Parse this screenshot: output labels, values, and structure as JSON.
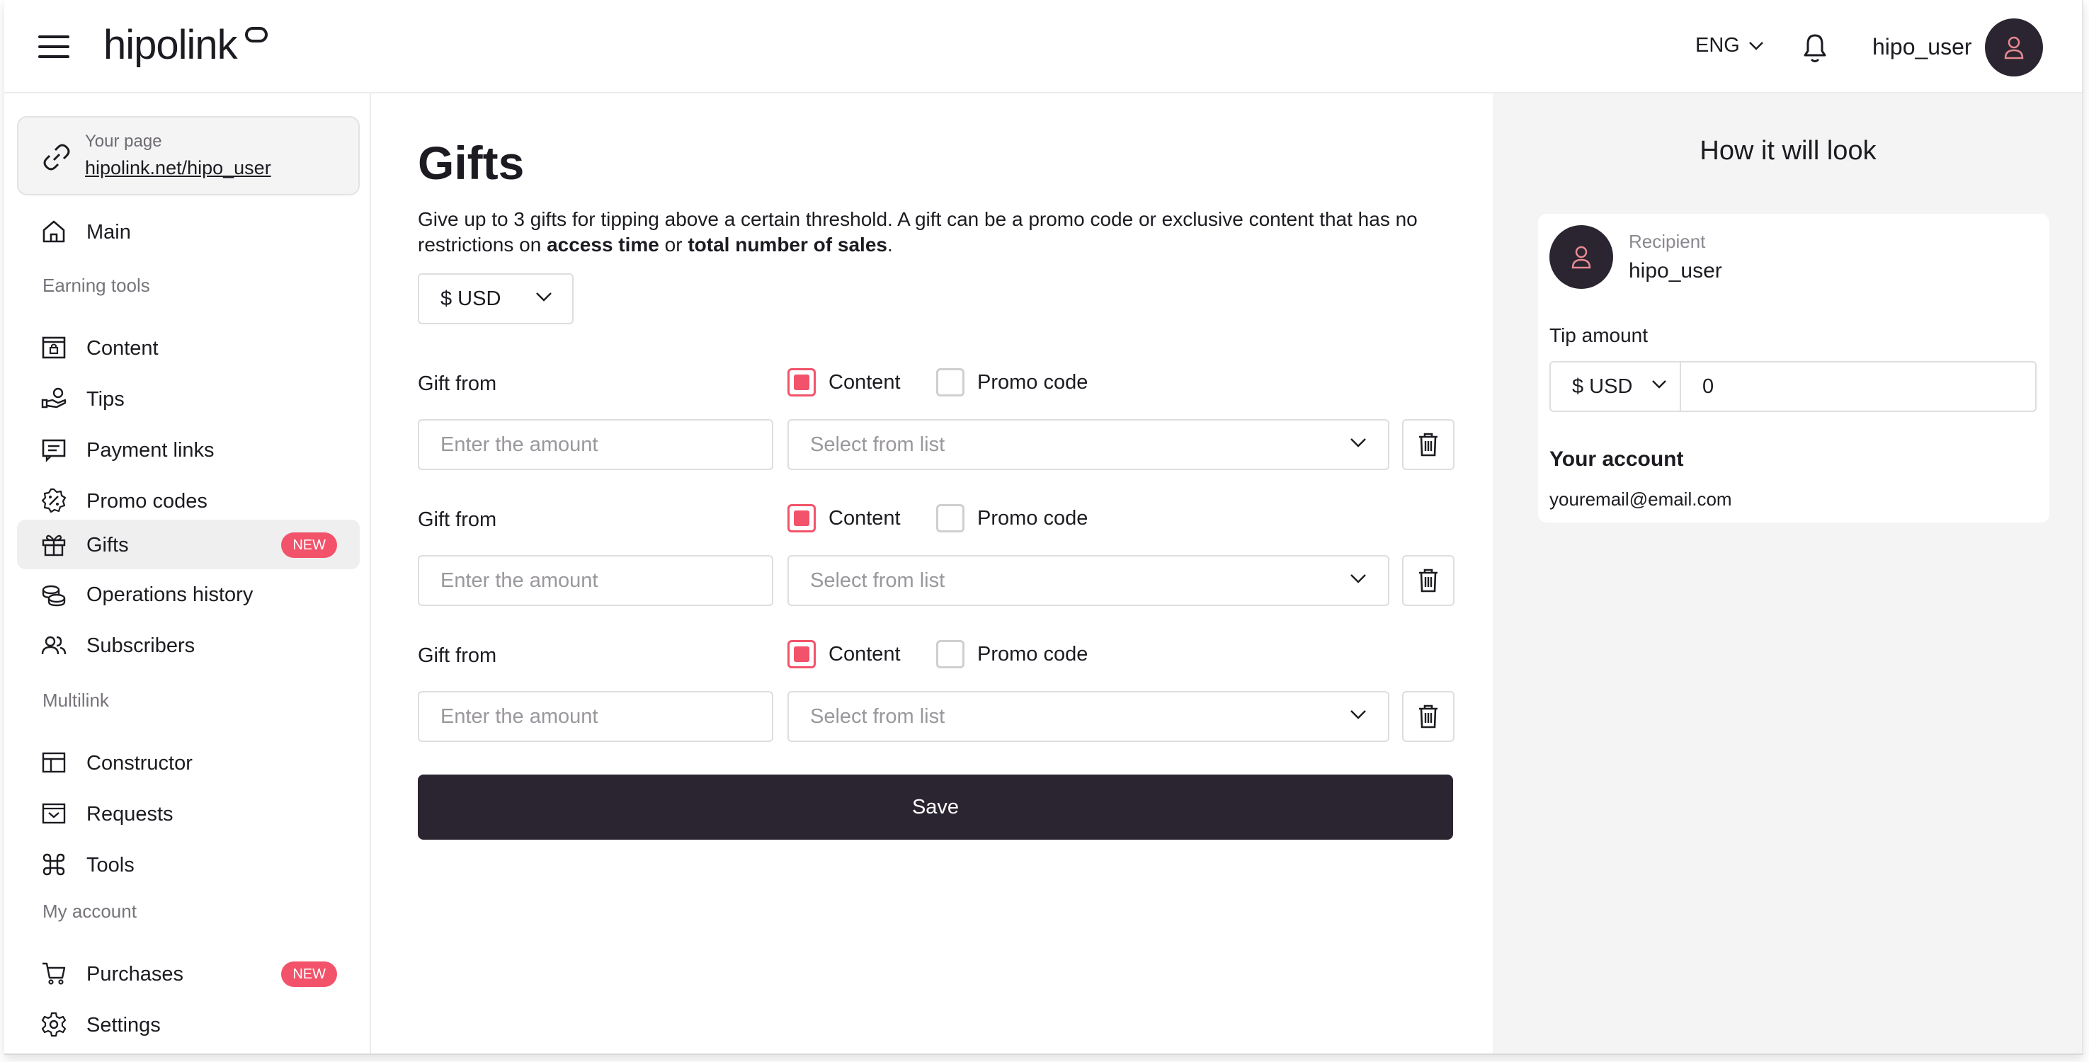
{
  "header": {
    "logo": "hipolink",
    "language": "ENG",
    "username": "hipo_user"
  },
  "sidebar": {
    "your_page_label": "Your page",
    "your_page_url": "hipolink.net/hipo_user",
    "sections": {
      "earning": "Earning tools",
      "multilink": "Multilink",
      "account": "My account"
    },
    "items": [
      {
        "label": "Main",
        "icon": "home-icon"
      },
      {
        "label": "Content",
        "icon": "content-icon"
      },
      {
        "label": "Tips",
        "icon": "tips-icon"
      },
      {
        "label": "Payment links",
        "icon": "payment-links-icon"
      },
      {
        "label": "Promo codes",
        "icon": "promo-codes-icon"
      },
      {
        "label": "Gifts",
        "icon": "gift-icon",
        "badge": "NEW",
        "active": true
      },
      {
        "label": "Operations history",
        "icon": "coins-icon"
      },
      {
        "label": "Subscribers",
        "icon": "users-icon"
      },
      {
        "label": "Constructor",
        "icon": "layout-icon"
      },
      {
        "label": "Requests",
        "icon": "inbox-icon"
      },
      {
        "label": "Tools",
        "icon": "command-icon"
      },
      {
        "label": "Purchases",
        "icon": "cart-icon",
        "badge": "NEW"
      },
      {
        "label": "Settings",
        "icon": "gear-icon"
      }
    ]
  },
  "main": {
    "title": "Gifts",
    "description_part1": "Give up to 3 gifts for tipping above a certain threshold. A gift can be a promo code or exclusive content that has no restrictions on ",
    "description_bold1": "access time",
    "description_or": " or ",
    "description_bold2": "total number of sales",
    "description_end": ".",
    "currency": "$ USD",
    "gifts": [
      {
        "label": "Gift from",
        "content_label": "Content",
        "content_checked": true,
        "promo_label": "Promo code",
        "promo_checked": false,
        "amount_placeholder": "Enter the amount",
        "select_placeholder": "Select from list"
      },
      {
        "label": "Gift from",
        "content_label": "Content",
        "content_checked": true,
        "promo_label": "Promo code",
        "promo_checked": false,
        "amount_placeholder": "Enter the amount",
        "select_placeholder": "Select from list"
      },
      {
        "label": "Gift from",
        "content_label": "Content",
        "content_checked": true,
        "promo_label": "Promo code",
        "promo_checked": false,
        "amount_placeholder": "Enter the amount",
        "select_placeholder": "Select from list"
      }
    ],
    "save_label": "Save"
  },
  "preview": {
    "title": "How it will look",
    "recipient_label": "Recipient",
    "recipient_name": "hipo_user",
    "tip_label": "Tip amount",
    "tip_currency": "$ USD",
    "tip_value": "0",
    "account_label": "Your account",
    "account_email": "youremail@email.com"
  },
  "colors": {
    "accent": "#f2536a",
    "dark": "#2a2530",
    "avatar_glyph": "#e88a92"
  }
}
